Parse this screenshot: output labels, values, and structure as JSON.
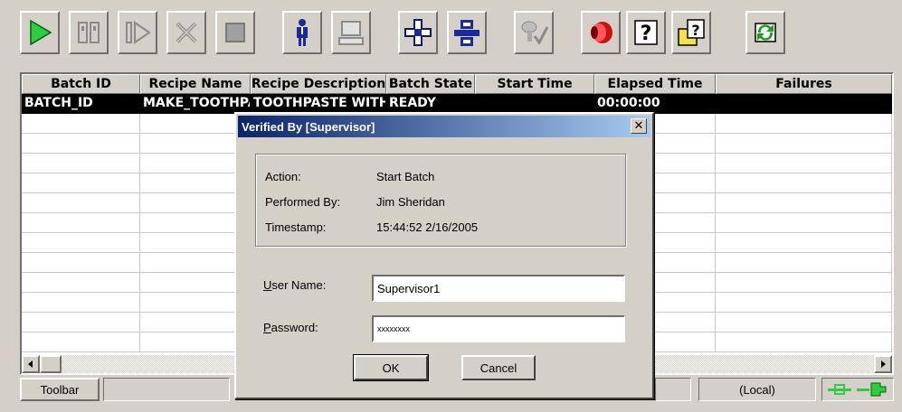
{
  "toolbar": {
    "buttons": [
      {
        "name": "start-icon"
      },
      {
        "name": "hold-icon"
      },
      {
        "name": "restart-icon"
      },
      {
        "name": "abort-icon"
      },
      {
        "name": "stop-icon"
      },
      {
        "name": "operator-icon"
      },
      {
        "name": "computer-icon"
      },
      {
        "name": "add-batch-icon"
      },
      {
        "name": "insert-icon"
      },
      {
        "name": "verify-icon"
      },
      {
        "name": "alarm-icon"
      },
      {
        "name": "help-icon"
      },
      {
        "name": "context-help-icon"
      },
      {
        "name": "refresh-icon"
      }
    ]
  },
  "grid": {
    "columns": [
      "Batch ID",
      "Recipe Name",
      "Recipe Description",
      "Batch State",
      "Start Time",
      "Elapsed Time",
      "Failures"
    ],
    "rows": [
      [
        "BATCH_ID",
        "MAKE_TOOTHPA:",
        "TOOTHPASTE WITH",
        "READY",
        "",
        "00:00:00",
        ""
      ]
    ]
  },
  "statusbar": {
    "toolbar_label": "Toolbar",
    "location": "(Local)"
  },
  "dialog": {
    "title": "Verified By [Supervisor]",
    "close_glyph": "✕",
    "info": {
      "action_label": "Action:",
      "action_value": "Start Batch",
      "performed_label": "Performed By:",
      "performed_value": "Jim Sheridan",
      "timestamp_label": "Timestamp:",
      "timestamp_value": "15:44:52 2/16/2005"
    },
    "username_label": "User Name:",
    "username_value": "Supervisor1",
    "password_label": "Password:",
    "password_value": "xxxxxxxx",
    "ok_label": "OK",
    "cancel_label": "Cancel"
  },
  "colors": {
    "face": "#d4d0c8",
    "selection": "#000000",
    "title_start": "#0a246a",
    "title_end": "#a6caf0"
  }
}
